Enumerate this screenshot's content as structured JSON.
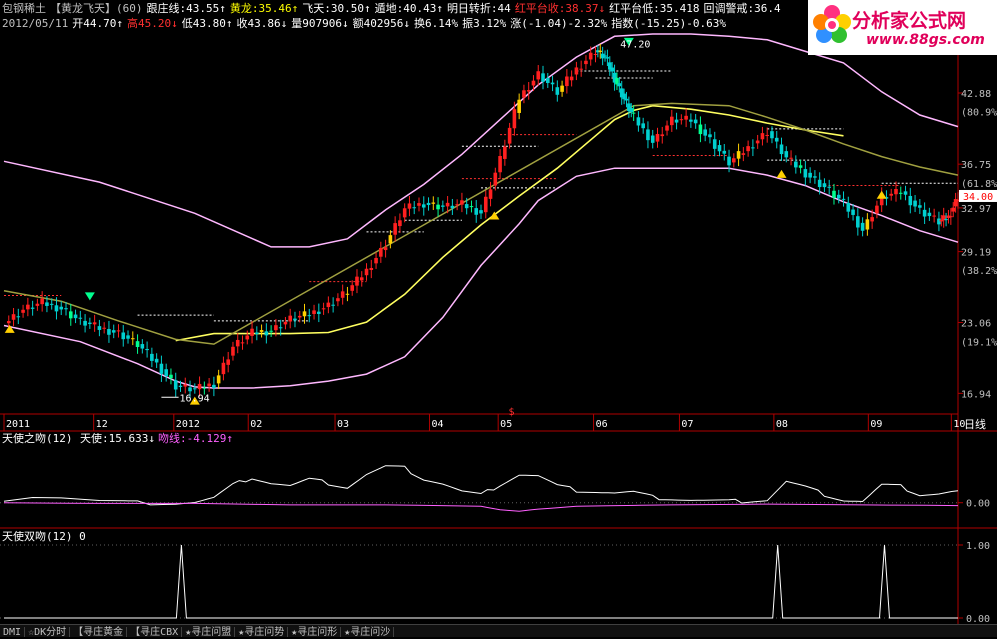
{
  "header": {
    "row1": [
      {
        "text": "包钢稀土",
        "color": "#c0c0c0"
      },
      {
        "text": "【黄龙飞天】(60)",
        "color": "#c0c0c0"
      },
      {
        "text": "跟庄线:43.55↑",
        "color": "#ffffff"
      },
      {
        "text": "黄龙:35.46↑",
        "color": "#ffff00"
      },
      {
        "text": "飞天:30.50↑",
        "color": "#ffffff"
      },
      {
        "text": "遁地:40.43↑",
        "color": "#ffffff"
      },
      {
        "text": "明日转折:44",
        "color": "#ffffff"
      },
      {
        "text": "红平台收:38.37↓",
        "color": "#ff3030"
      },
      {
        "text": "红平台低:35.418",
        "color": "#ffffff"
      },
      {
        "text": "回调警戒:36.4",
        "color": "#ffffff"
      }
    ],
    "row2": [
      {
        "text": "2012/05/11",
        "color": "#c0c0c0"
      },
      {
        "text": "开44.70↑",
        "color": "#ffffff"
      },
      {
        "text": "高45.20↓",
        "color": "#ff3030"
      },
      {
        "text": "低43.80↑",
        "color": "#ffffff"
      },
      {
        "text": "收43.86↓",
        "color": "#ffffff"
      },
      {
        "text": "量907906↓",
        "color": "#ffffff"
      },
      {
        "text": "额402956↓",
        "color": "#ffffff"
      },
      {
        "text": "换6.14%",
        "color": "#ffffff"
      },
      {
        "text": "振3.12%",
        "color": "#ffffff"
      },
      {
        "text": "涨(-1.04)-2.32%",
        "color": "#ffffff"
      },
      {
        "text": "指数(-15.25)-0.63%",
        "color": "#ffffff"
      }
    ]
  },
  "logo": {
    "line1": "分析家公式网",
    "line2": "www.88gs.com",
    "color": "#e0005a"
  },
  "chart_data": [
    {
      "type": "candlestick",
      "ylim": [
        15.5,
        48
      ],
      "y_ticks": [
        "42.88",
        "(80.9%)",
        "36.75",
        "(61.8%)",
        "32.97",
        "29.19",
        "(38.2%)",
        "23.06",
        "(19.1%)",
        "16.94"
      ],
      "current_price": "34.00",
      "x_tick_labels": [
        "2011",
        "12",
        "2012",
        "02",
        "03",
        "04",
        "05",
        "06",
        "07",
        "08",
        "09",
        "10"
      ],
      "period_label": "日线",
      "annotations": [
        "47.20",
        "16.94"
      ],
      "series": [
        {
          "name": "upper_band",
          "color": "#ffb8ff",
          "x": [
            0,
            10,
            20,
            28,
            32,
            36,
            40,
            44,
            48,
            52,
            56,
            60,
            64,
            68,
            72,
            76,
            80,
            84,
            88,
            92,
            96,
            100
          ],
          "values": [
            37,
            35.2,
            32.5,
            29.6,
            29.6,
            30.3,
            32.8,
            35,
            37.6,
            40.6,
            43.6,
            46,
            47.8,
            48,
            48,
            47.8,
            47.5,
            46.5,
            45.5,
            43,
            41,
            40
          ]
        },
        {
          "name": "lower_band",
          "color": "#ffb8ff",
          "x": [
            0,
            8,
            14,
            18,
            20,
            22,
            26,
            30,
            34,
            38,
            42,
            46,
            50,
            54,
            56,
            60,
            64,
            68,
            72,
            76,
            80,
            84,
            88,
            92,
            96,
            100
          ],
          "values": [
            22.8,
            21.4,
            19.5,
            18,
            17.5,
            17.4,
            17.4,
            17.6,
            18,
            18.6,
            20.1,
            23.5,
            28,
            31.6,
            33.6,
            35.7,
            36.4,
            36.4,
            36.4,
            36.4,
            35.8,
            34.9,
            33.5,
            32.3,
            31,
            30
          ]
        },
        {
          "name": "mid_line",
          "color": "#ffff60",
          "x": [
            18,
            22,
            26,
            30,
            34,
            38,
            42,
            46,
            50,
            54,
            58,
            62,
            64,
            66,
            68,
            72,
            76,
            80,
            84,
            88
          ],
          "values": [
            21.5,
            22.1,
            22.1,
            22.1,
            22.2,
            23.1,
            25.5,
            28.7,
            31.5,
            34,
            36.4,
            39.2,
            40.6,
            41.4,
            41.8,
            41.5,
            41,
            40.3,
            39.7,
            39.2
          ]
        },
        {
          "name": "ma_line",
          "color": "#a0a040",
          "x": [
            0,
            6,
            12,
            18,
            22,
            66,
            70,
            76,
            80,
            84,
            88,
            92,
            96,
            100
          ],
          "values": [
            25.8,
            24.9,
            23.2,
            21.6,
            21.2,
            41.8,
            42,
            41.8,
            40.8,
            39.7,
            38.5,
            37.4,
            36.5,
            35.8
          ]
        },
        {
          "name": "price_close",
          "color": "#00e0e0",
          "x": [
            0,
            2,
            4,
            6,
            8,
            10,
            12,
            14,
            16,
            18,
            20,
            22,
            24,
            26,
            28,
            30,
            32,
            34,
            36,
            38,
            40,
            42,
            44,
            46,
            48,
            50,
            52,
            54,
            56,
            58,
            60,
            62,
            63,
            64,
            65,
            66,
            68,
            70,
            72,
            74,
            76,
            78,
            80,
            82,
            84,
            86,
            88,
            90,
            92,
            94,
            96,
            98,
            99,
            100
          ],
          "values": [
            23,
            24.2,
            24.8,
            24.3,
            23.2,
            22.6,
            22.2,
            21.2,
            19.5,
            17.6,
            17.3,
            17.8,
            21,
            22.2,
            22.4,
            23.4,
            23.8,
            24.6,
            25.8,
            27.6,
            29.9,
            32.9,
            33.4,
            33.1,
            33.3,
            32.6,
            37.2,
            42.5,
            44.6,
            43,
            45,
            46.6,
            46,
            44.2,
            42.4,
            40.8,
            38.7,
            40.6,
            40.6,
            38.9,
            36.9,
            38.2,
            39.6,
            37.3,
            36,
            34.8,
            33.4,
            31.1,
            33.9,
            34.4,
            32.8,
            31.8,
            32.2,
            34
          ]
        }
      ]
    },
    {
      "type": "line",
      "title": "天使之吻(12)",
      "legend": [
        {
          "name": "天使",
          "value": "15.633↓",
          "color": "#ffffff"
        },
        {
          "name": "吻线",
          "value": "-4.129↑",
          "color": "#ff60ff"
        }
      ],
      "ylim": [
        -30,
        80
      ],
      "y_ticks": [
        "0.00"
      ],
      "series": [
        {
          "name": "天使",
          "color": "#ffffff",
          "x": [
            0,
            3,
            6,
            10,
            14,
            18,
            20,
            22,
            24,
            26,
            28,
            30,
            32,
            34,
            36,
            38,
            40,
            42,
            44,
            46,
            48,
            50,
            52,
            54,
            56,
            58,
            60,
            62,
            64,
            66,
            68,
            70,
            72,
            74,
            76,
            78,
            80,
            82,
            84,
            86,
            88,
            90,
            92,
            94,
            96,
            98,
            100
          ],
          "values": [
            5,
            9,
            7,
            2,
            0,
            0,
            1,
            7,
            25,
            36,
            28,
            24,
            33,
            28,
            22,
            40,
            51,
            49,
            34,
            27,
            16,
            11,
            26,
            40,
            38,
            24,
            18,
            16,
            14,
            15,
            8,
            6,
            4,
            3,
            2,
            3,
            4,
            30,
            22,
            12,
            4,
            2,
            25,
            23,
            12,
            13,
            17
          ]
        },
        {
          "name": "吻线",
          "color": "#ff60ff",
          "x": [
            0,
            10,
            20,
            30,
            40,
            50,
            52,
            54,
            56,
            60,
            70,
            80,
            90,
            100
          ],
          "values": [
            0,
            -1,
            -1,
            -3,
            -3,
            -5,
            -10,
            -12,
            -9,
            -5,
            -3,
            -2,
            -3,
            -4
          ]
        }
      ]
    },
    {
      "type": "line",
      "title": "天使双吻(12) 0",
      "ylim": [
        0,
        1
      ],
      "y_ticks": [
        "1.00",
        "0.00"
      ],
      "series": [
        {
          "name": "signal",
          "color": "#ffffff",
          "spikes_at": [
            18.6,
            81.1,
            92.3
          ],
          "spike_value": 1
        }
      ]
    }
  ],
  "bottom_tabs": [
    "DMI",
    "☆DK分时",
    "【寻庄黄金",
    "【寻庄CBX",
    "★寻庄问盟",
    "★寻庄问势",
    "★寻庄问形",
    "★寻庄问沙"
  ]
}
